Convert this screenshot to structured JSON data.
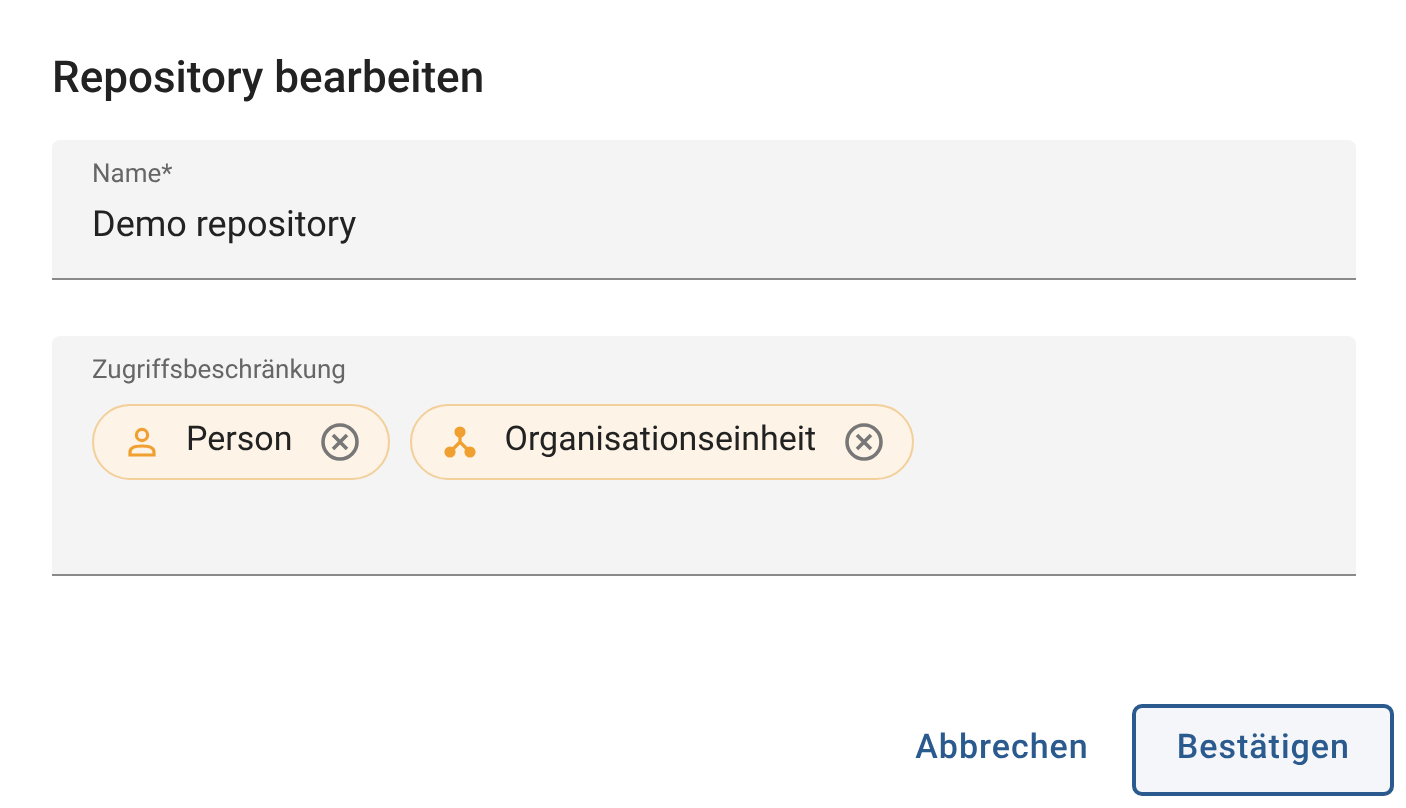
{
  "dialog": {
    "title": "Repository bearbeiten"
  },
  "name_field": {
    "label": "Name*",
    "value": "Demo repository"
  },
  "access_field": {
    "label": "Zugriffsbeschränkung",
    "chips": [
      {
        "kind": "person",
        "label": "Person"
      },
      {
        "kind": "org_unit",
        "label": "Organisationseinheit"
      }
    ]
  },
  "buttons": [
    {
      "kind": "text",
      "label": "Abbrechen"
    },
    {
      "kind": "outlined",
      "label": "Bestätigen"
    }
  ]
}
